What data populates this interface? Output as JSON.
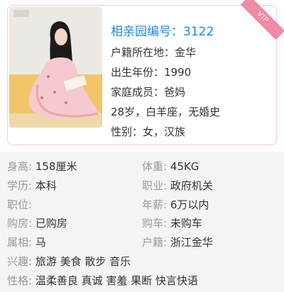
{
  "profile": {
    "badge": "VIP",
    "id_label": "相亲园编号：",
    "id_value": "3122",
    "hometown": "户籍所在地：金华",
    "birth_year": "出生年份：1990",
    "family": "家庭成员：爸妈",
    "summary": "28岁，白羊座，无婚史",
    "gender": "性别：女，汉族"
  },
  "details": {
    "height": {
      "label": "身高:",
      "value": "158厘米"
    },
    "weight": {
      "label": "体重:",
      "value": "45KG"
    },
    "education": {
      "label": "学历:",
      "value": "本科"
    },
    "job": {
      "label": "职业:",
      "value": "政府机关"
    },
    "position": {
      "label": "职位:",
      "value": ""
    },
    "salary": {
      "label": "年薪:",
      "value": "6万以内"
    },
    "house": {
      "label": "购房:",
      "value": "已购房"
    },
    "car": {
      "label": "购车:",
      "value": "未购车"
    },
    "zodiac": {
      "label": "属相:",
      "value": "马"
    },
    "hukou": {
      "label": "户籍:",
      "value": "浙江金华"
    },
    "hobbies": {
      "label": "兴趣:",
      "value": "旅游 美食 散步 音乐"
    },
    "personality": {
      "label": "性格:",
      "value": "温柔善良 真诚 害羞 果断 快言快语"
    }
  }
}
